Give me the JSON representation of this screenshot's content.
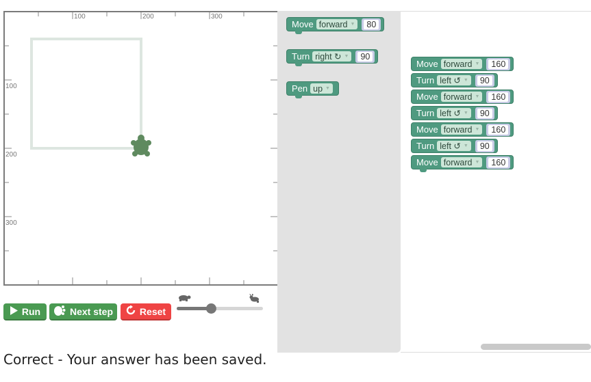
{
  "canvas": {
    "x_ticks": [
      "100",
      "200",
      "300"
    ],
    "y_ticks": [
      "100",
      "200",
      "300"
    ],
    "turtle_icon": "turtle-icon"
  },
  "controls": {
    "run_label": "Run",
    "run_icon": "play-icon",
    "step_label": "Next step",
    "step_icon": "footprint-icon",
    "reset_label": "Reset",
    "reset_icon": "reset-icon",
    "speed_slow_icon": "turtle-icon",
    "speed_fast_icon": "rabbit-icon",
    "speed_value": 0.4
  },
  "toolbox": {
    "move": {
      "keyword": "Move",
      "direction": "forward",
      "distance": "80"
    },
    "turn": {
      "keyword": "Turn",
      "direction": "right ↻",
      "angle": "90"
    },
    "pen": {
      "keyword": "Pen",
      "state": "up"
    }
  },
  "program": [
    {
      "keyword": "Move",
      "option": "forward",
      "value": "160"
    },
    {
      "keyword": "Turn",
      "option": "left ↺",
      "value": "90"
    },
    {
      "keyword": "Move",
      "option": "forward",
      "value": "160"
    },
    {
      "keyword": "Turn",
      "option": "left ↺",
      "value": "90"
    },
    {
      "keyword": "Move",
      "option": "forward",
      "value": "160"
    },
    {
      "keyword": "Turn",
      "option": "left ↺",
      "value": "90"
    },
    {
      "keyword": "Move",
      "option": "forward",
      "value": "160"
    }
  ],
  "status": {
    "message": "Correct - Your answer has been saved."
  },
  "colors": {
    "run": "#4a9a52",
    "reset": "#ef4444",
    "block": "#4f9a80",
    "path": "#dde6e0",
    "turtle": "#5f8a5f"
  }
}
